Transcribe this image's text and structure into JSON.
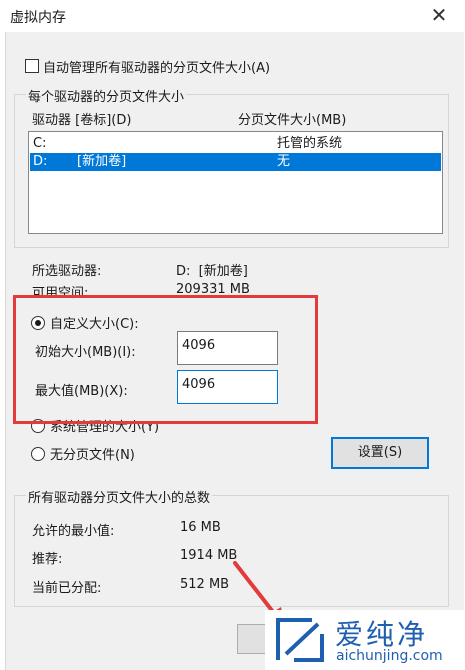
{
  "window": {
    "title": "虚拟内存",
    "close_glyph": "✕"
  },
  "auto_manage": {
    "label": "自动管理所有驱动器的分页文件大小(A)",
    "checked": false
  },
  "drives_group": {
    "label": "每个驱动器的分页文件大小",
    "col_drive": "驱动器 [卷标](D)",
    "col_size": "分页文件大小(MB)",
    "rows": [
      {
        "drive": "C:",
        "volume": "",
        "size": "托管的系统",
        "selected": false
      },
      {
        "drive": "D:",
        "volume": "[新加卷]",
        "size": "无",
        "selected": true
      }
    ]
  },
  "selected_drive": {
    "label": "所选驱动器:",
    "value": "D:  [新加卷]",
    "free_label": "可用空间:",
    "free_value": "209331 MB"
  },
  "options": {
    "custom_label": "自定义大小(C):",
    "initial_label": "初始大小(MB)(I):",
    "initial_value": "4096",
    "max_label": "最大值(MB)(X):",
    "max_value": "4096",
    "system_label": "系统管理的大小(Y)",
    "none_label": "无分页文件(N)",
    "selected_option": "custom",
    "set_button": "设置(S)"
  },
  "totals": {
    "label": "所有驱动器分页文件大小的总数",
    "min_label": "允许的最小值:",
    "min_value": "16 MB",
    "rec_label": "推荐:",
    "rec_value": "1914 MB",
    "cur_label": "当前已分配:",
    "cur_value": "512 MB"
  },
  "watermark": {
    "brand": "爱纯净",
    "url": "aichunjing.com"
  },
  "colors": {
    "selection": "#0078d7",
    "annotation_red": "#e33b3b",
    "watermark_blue": "#1f5fb0"
  }
}
